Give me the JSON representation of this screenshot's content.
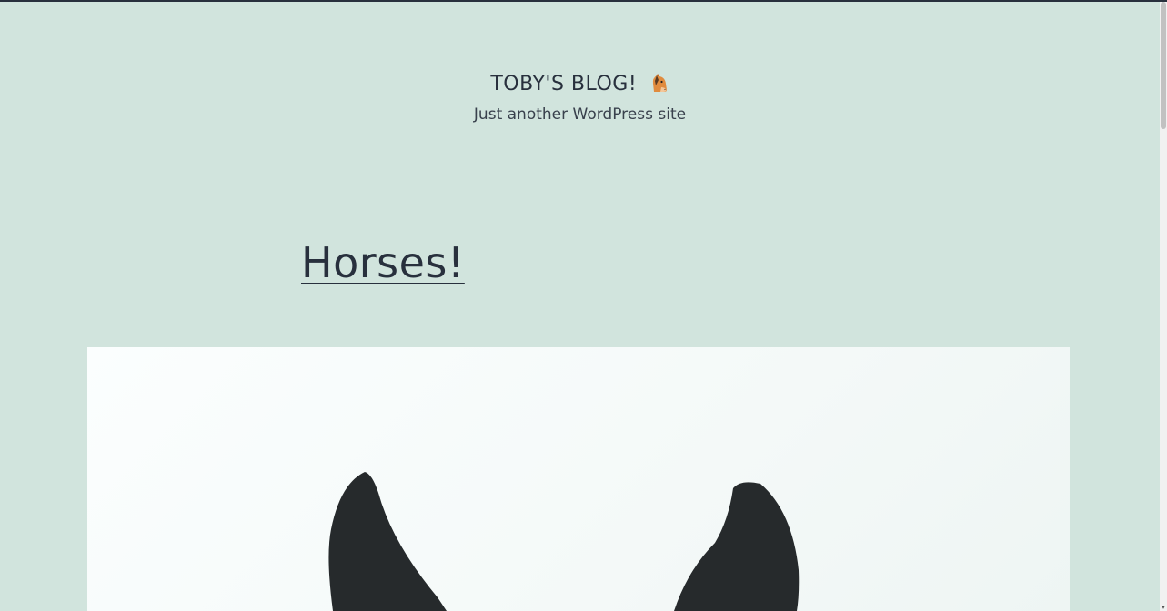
{
  "site": {
    "title": "TOBY'S BLOG!",
    "title_icon": "horse-face-icon",
    "tagline": "Just another WordPress site"
  },
  "post": {
    "title": "Horses!"
  },
  "featured_image": {
    "subject": "horse-ears-illustration"
  },
  "colors": {
    "background": "#d1e4dd",
    "text": "#28303d",
    "image_bg": "#f6fbfa",
    "horse": "#262a2c"
  }
}
